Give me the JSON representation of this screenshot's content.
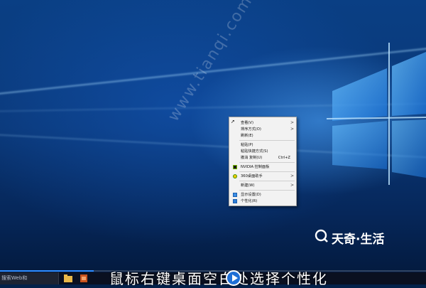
{
  "context_menu": {
    "items": [
      {
        "label": "查看(V)",
        "has_submenu": true
      },
      {
        "label": "排序方式(O)",
        "has_submenu": true
      },
      {
        "label": "刷新(E)"
      },
      {
        "label": "粘贴(P)"
      },
      {
        "label": "粘贴快捷方式(S)"
      },
      {
        "label": "撤消 复制(U)",
        "shortcut": "Ctrl+Z"
      },
      {
        "label": "NVIDIA 控制面板",
        "icon": "nvidia-icon"
      },
      {
        "label": "360桌面助手",
        "icon": "360-icon",
        "has_submenu": true
      },
      {
        "label": "新建(W)",
        "has_submenu": true
      },
      {
        "label": "显示设置(D)",
        "icon": "display-icon"
      },
      {
        "label": "个性化(R)",
        "icon": "personalize-icon"
      }
    ],
    "arrow_glyph": ">"
  },
  "watermark": "www.tianqi.com",
  "brand": {
    "name": "天奇·生活"
  },
  "taskbar": {
    "search_label": "搜索Web和",
    "progress": 0.22
  },
  "subtitle": "鼠标右键桌面空白处选择个性化",
  "colors": {
    "menu_bg": "#f2f2f2",
    "desktop_blue": "#0a3f84",
    "accent": "#2f8cff"
  }
}
